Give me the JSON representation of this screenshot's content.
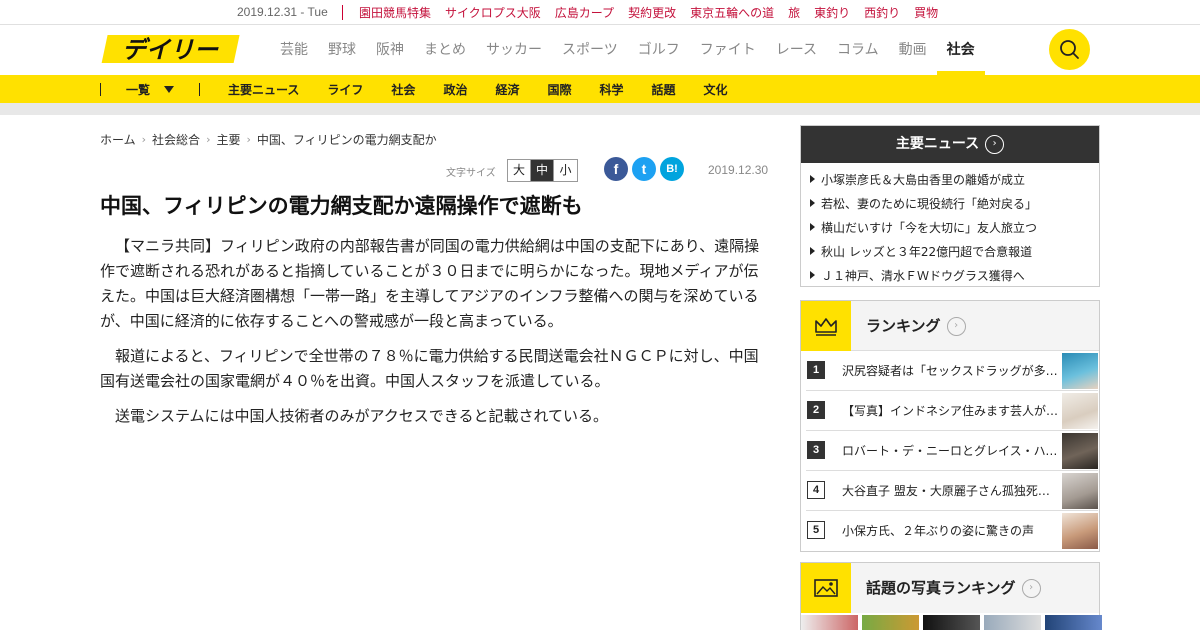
{
  "topbar": {
    "date": "2019.12.31 - Tue",
    "links": [
      "園田競馬特集",
      "サイクロプス大阪",
      "広島カープ",
      "契約更改",
      "東京五輪への道",
      "旅",
      "東釣り",
      "西釣り",
      "買物"
    ]
  },
  "header": {
    "logo_text": "デイリー",
    "nav": [
      "芸能",
      "野球",
      "阪神",
      "まとめ",
      "サッカー",
      "スポーツ",
      "ゴルフ",
      "ファイト",
      "レース",
      "コラム",
      "動画",
      "社会"
    ],
    "active_nav": "社会",
    "search_icon": "search-icon"
  },
  "subnav": {
    "list_label": "一覧",
    "items": [
      "主要ニュース",
      "ライフ",
      "社会",
      "政治",
      "経済",
      "国際",
      "科学",
      "話題",
      "文化"
    ]
  },
  "breadcrumb": [
    "ホーム",
    "社会総合",
    "主要",
    "中国、フィリピンの電力網支配か"
  ],
  "tools": {
    "font_size_label": "文字サイズ",
    "font_sizes": [
      "大",
      "中",
      "小"
    ],
    "selected_size": "中",
    "share": {
      "facebook": "f",
      "twitter": "t",
      "hatena": "B!"
    },
    "date": "2019.12.30"
  },
  "article": {
    "headline": "中国、フィリピンの電力網支配か遠隔操作で遮断も",
    "paragraphs": [
      "【マニラ共同】フィリピン政府の内部報告書が同国の電力供給網は中国の支配下にあり、遠隔操作で遮断される恐れがあると指摘していることが３０日までに明らかになった。現地メディアが伝えた。中国は巨大経済圏構想「一帯一路」を主導してアジアのインフラ整備への関与を深めているが、中国に経済的に依存することへの警戒感が一段と高まっている。",
      "報道によると、フィリピンで全世帯の７８％に電力供給する民間送電会社ＮＧＣＰに対し、中国国有送電会社の国家電網が４０％を出資。中国人スタッフを派遣している。",
      "送電システムには中国人技術者のみがアクセスできると記載されている。"
    ]
  },
  "sidebar": {
    "major_news": {
      "title": "主要ニュース",
      "items": [
        "小塚崇彦氏＆大島由香里の離婚が成立",
        "若松、妻のために現役続行「絶対戻る」",
        "横山だいすけ「今を大切に」友人旅立つ",
        "秋山 レッズと３年22億円超で合意報道",
        "Ｊ１神戸、清水ＦＷドウグラス獲得へ"
      ]
    },
    "ranking": {
      "title": "ランキング",
      "items": [
        {
          "rank": "1",
          "text": "沢尻容疑者は「セックスドラッグが多数」"
        },
        {
          "rank": "2",
          "text": "【写真】インドネシア住みます芸人が結婚"
        },
        {
          "rank": "3",
          "text": "ロバート・デ・ニーロとグレイス・ハイタワー"
        },
        {
          "rank": "4",
          "text": "大谷直子 盟友・大原麗子さん孤独死の真相"
        },
        {
          "rank": "5",
          "text": "小保方氏、２年ぶりの姿に驚きの声"
        }
      ]
    },
    "photo_ranking": {
      "title": "話題の写真ランキング"
    }
  },
  "colors": {
    "brand_yellow": "#ffe100",
    "topbar_red": "#c4123c",
    "dark": "#333333"
  }
}
